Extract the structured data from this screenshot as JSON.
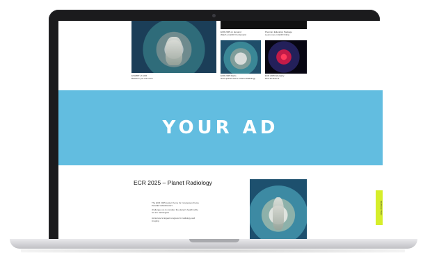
{
  "ad_banner": {
    "text": "YOUR AD",
    "background": "#62bde0"
  },
  "top_items": {
    "big_title": "EXHIBIT of ECR",
    "big_sub": "Between you and more",
    "news_title": "ECR 2025 on demand",
    "news_sub": "Watch on ECR On-Demand",
    "pkg_title": "Premium Education Package",
    "pkg_sub": "Learn more in ECR Online",
    "small1_title": "ECR 2025 Radio",
    "small1_sub": "Next quarter theme: Planet Radiology",
    "small2_title": "ECR 2025 Afterparty",
    "small2_sub": "Find all about it"
  },
  "article": {
    "title": "ECR 2025 – Planet Radiology",
    "para1": "The ECR 2025 poster theme for congresses theme PLANET RADIOLOGY",
    "para2": "challenges us to consider the planet's health while we are radiologists",
    "para3": "As Europe's largest congress for radiology and imaging",
    "side_tab": "NEWSLETTER"
  },
  "accent_colors": {
    "ad_band": "#62bde0",
    "side_tab": "#d6ee2a"
  }
}
